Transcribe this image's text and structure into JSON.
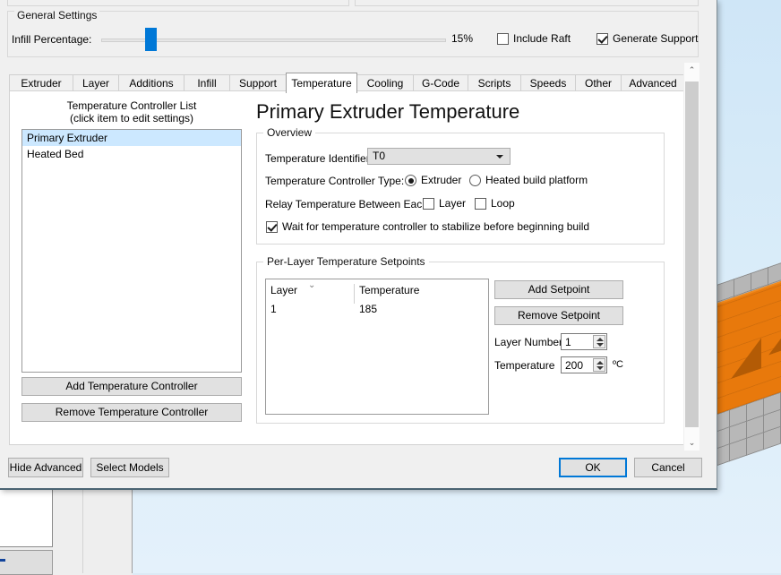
{
  "general": {
    "legend": "General Settings",
    "infill_label": "Infill Percentage:",
    "infill_value": "15%",
    "include_raft_label": "Include Raft",
    "include_raft_checked": false,
    "generate_support_label": "Generate Support",
    "generate_support_checked": true
  },
  "tabs": [
    {
      "label": "Extruder",
      "active": false
    },
    {
      "label": "Layer",
      "active": false
    },
    {
      "label": "Additions",
      "active": false
    },
    {
      "label": "Infill",
      "active": false
    },
    {
      "label": "Support",
      "active": false
    },
    {
      "label": "Temperature",
      "active": true
    },
    {
      "label": "Cooling",
      "active": false
    },
    {
      "label": "G-Code",
      "active": false
    },
    {
      "label": "Scripts",
      "active": false
    },
    {
      "label": "Speeds",
      "active": false
    },
    {
      "label": "Other",
      "active": false
    },
    {
      "label": "Advanced",
      "active": false
    }
  ],
  "controller_list": {
    "title_line1": "Temperature Controller List",
    "title_line2": "(click item to edit settings)",
    "items": [
      {
        "label": "Primary Extruder",
        "selected": true
      },
      {
        "label": "Heated Bed",
        "selected": false
      }
    ],
    "add_button": "Add Temperature Controller",
    "remove_button": "Remove Temperature Controller"
  },
  "page_title": "Primary Extruder Temperature",
  "overview": {
    "legend": "Overview",
    "temp_identifier_label": "Temperature Identifier",
    "temp_identifier_value": "T0",
    "controller_type_label": "Temperature Controller Type:",
    "radio_extruder": "Extruder",
    "radio_platform": "Heated build platform",
    "radio_selected": "Extruder",
    "relay_label": "Relay Temperature Between Each:",
    "relay_layer": "Layer",
    "relay_layer_checked": false,
    "relay_loop": "Loop",
    "relay_loop_checked": false,
    "wait_label": "Wait for temperature controller to stabilize before beginning build",
    "wait_checked": true
  },
  "setpoints": {
    "legend": "Per-Layer Temperature Setpoints",
    "columns": [
      "Layer",
      "Temperature"
    ],
    "sort_chevron": "⌄",
    "rows": [
      {
        "layer": "1",
        "temperature": "185"
      }
    ],
    "add_button": "Add Setpoint",
    "remove_button": "Remove Setpoint",
    "layer_number_label": "Layer Number",
    "layer_number_value": "1",
    "temperature_label": "Temperature",
    "temperature_value": "200",
    "celsius_unit": "ºC"
  },
  "footer": {
    "hide_advanced": "Hide Advanced",
    "select_models": "Select Models",
    "ok": "OK",
    "cancel": "Cancel"
  },
  "scrollbar": {
    "up_arrow": "⌃",
    "down_arrow": "⌄"
  },
  "colors": {
    "accent": "#0078d7",
    "selection": "#cce8ff",
    "model": "#e8790c",
    "dialog_bg": "#f0f0f0"
  }
}
